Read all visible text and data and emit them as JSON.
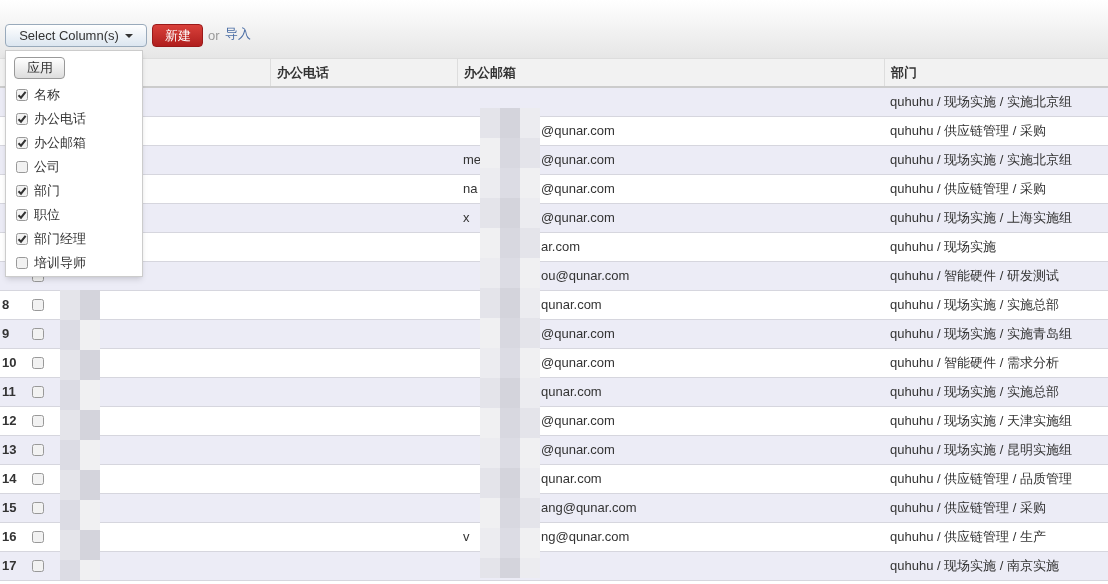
{
  "toolbar": {
    "column_button": "Select Column(s)",
    "new_button": "新建",
    "or_text": "or",
    "import_link": "导入"
  },
  "column_menu": {
    "apply_button": "应用",
    "items": [
      {
        "label": "名称",
        "checked": true
      },
      {
        "label": "办公电话",
        "checked": true
      },
      {
        "label": "办公邮箱",
        "checked": true
      },
      {
        "label": "公司",
        "checked": false
      },
      {
        "label": "部门",
        "checked": true
      },
      {
        "label": "职位",
        "checked": true
      },
      {
        "label": "部门经理",
        "checked": true
      },
      {
        "label": "培训导师",
        "checked": false
      }
    ]
  },
  "table": {
    "columns": [
      "办公电话",
      "办公邮箱",
      "部门"
    ],
    "rows": [
      {
        "email": {},
        "department": "quhuhu / 现场实施 / 实施北京组"
      },
      {
        "email": {
          "tail": "@qunar.com"
        },
        "department": "quhuhu / 供应链管理 / 采购"
      },
      {
        "email": {
          "lead": "me",
          "tail": "@qunar.com"
        },
        "department": "quhuhu / 现场实施 / 实施北京组"
      },
      {
        "email": {
          "lead": "na",
          "tail": "@qunar.com"
        },
        "department": "quhuhu / 供应链管理 / 采购"
      },
      {
        "email": {
          "lead": "x",
          "tail": "@qunar.com"
        },
        "department": "quhuhu / 现场实施 / 上海实施组"
      },
      {
        "email": {
          "tail": "ar.com"
        },
        "department": "quhuhu / 现场实施"
      },
      {
        "checked": false,
        "email": {
          "tail": "ou@qunar.com"
        },
        "department": "quhuhu / 智能硬件 / 研发测试"
      },
      {
        "number": "8",
        "checked": false,
        "email": {
          "tail": "qunar.com"
        },
        "department": "quhuhu / 现场实施 / 实施总部"
      },
      {
        "number": "9",
        "checked": false,
        "email": {
          "tail": "@qunar.com"
        },
        "department": "quhuhu / 现场实施 / 实施青岛组"
      },
      {
        "number": "10",
        "checked": false,
        "email": {
          "tail": "@qunar.com"
        },
        "department": "quhuhu / 智能硬件 / 需求分析"
      },
      {
        "number": "11",
        "checked": false,
        "email": {
          "tail": "qunar.com"
        },
        "department": "quhuhu / 现场实施 / 实施总部"
      },
      {
        "number": "12",
        "checked": false,
        "email": {
          "tail": "@qunar.com"
        },
        "department": "quhuhu / 现场实施 / 天津实施组"
      },
      {
        "number": "13",
        "checked": false,
        "email": {
          "tail": "@qunar.com"
        },
        "department": "quhuhu / 现场实施 / 昆明实施组"
      },
      {
        "number": "14",
        "checked": false,
        "email": {
          "tail": "qunar.com"
        },
        "department": "quhuhu / 供应链管理 / 品质管理"
      },
      {
        "number": "15",
        "checked": false,
        "email": {
          "tail": "ang@qunar.com"
        },
        "department": "quhuhu / 供应链管理 / 采购"
      },
      {
        "number": "16",
        "checked": false,
        "email": {
          "lead": "v",
          "tail": "ng@qunar.com"
        },
        "department": "quhuhu / 供应链管理 / 生产"
      },
      {
        "number": "17",
        "checked": false,
        "email": {},
        "department": "quhuhu / 现场实施 / 南京实施"
      }
    ]
  }
}
